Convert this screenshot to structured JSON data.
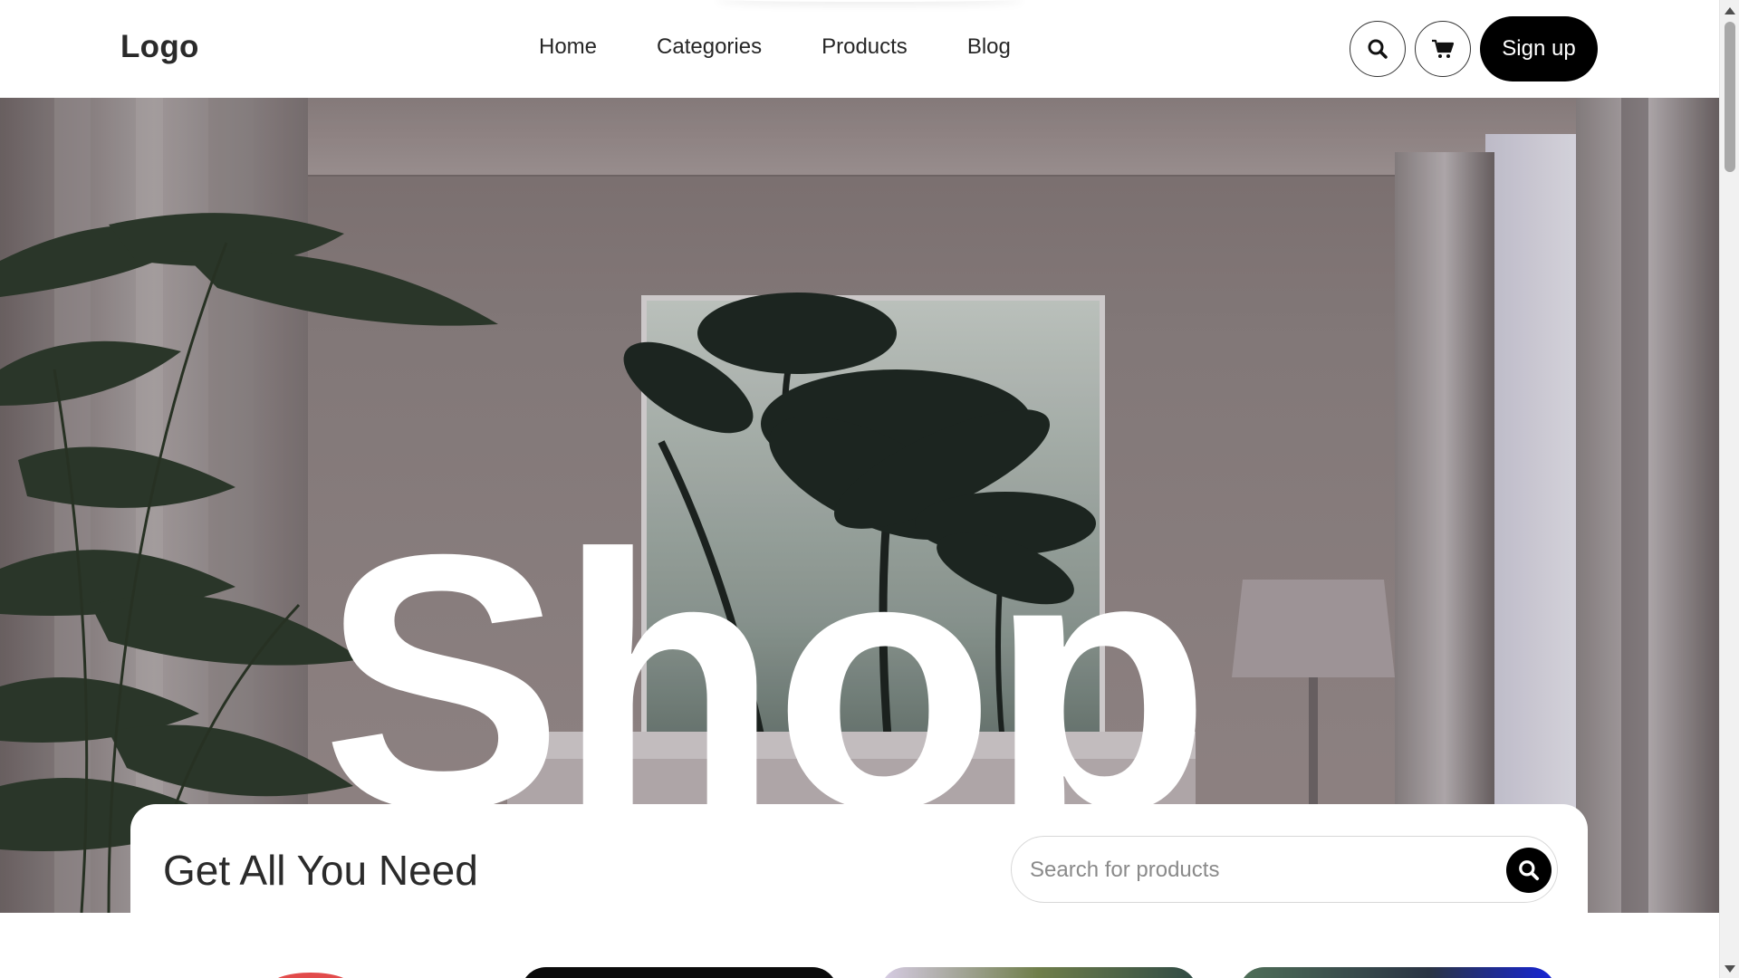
{
  "header": {
    "logo": "Logo",
    "nav": [
      "Home",
      "Categories",
      "Products",
      "Blog"
    ],
    "icons": {
      "search": "search-icon",
      "cart": "cart-icon"
    },
    "signup_label": "Sign up"
  },
  "hero": {
    "big_word": "Shop",
    "image_description_icon": "living-room-photo",
    "panel": {
      "title": "Get All You Need",
      "search_placeholder": "Search for products",
      "search_button_icon": "search-icon"
    }
  },
  "products": {
    "cards": [
      {
        "name": "product-card-1"
      },
      {
        "name": "product-card-2"
      },
      {
        "name": "product-card-3"
      },
      {
        "name": "product-card-4"
      }
    ]
  },
  "colors": {
    "accent": "#000000",
    "background": "#ffffff",
    "text": "#222222"
  }
}
